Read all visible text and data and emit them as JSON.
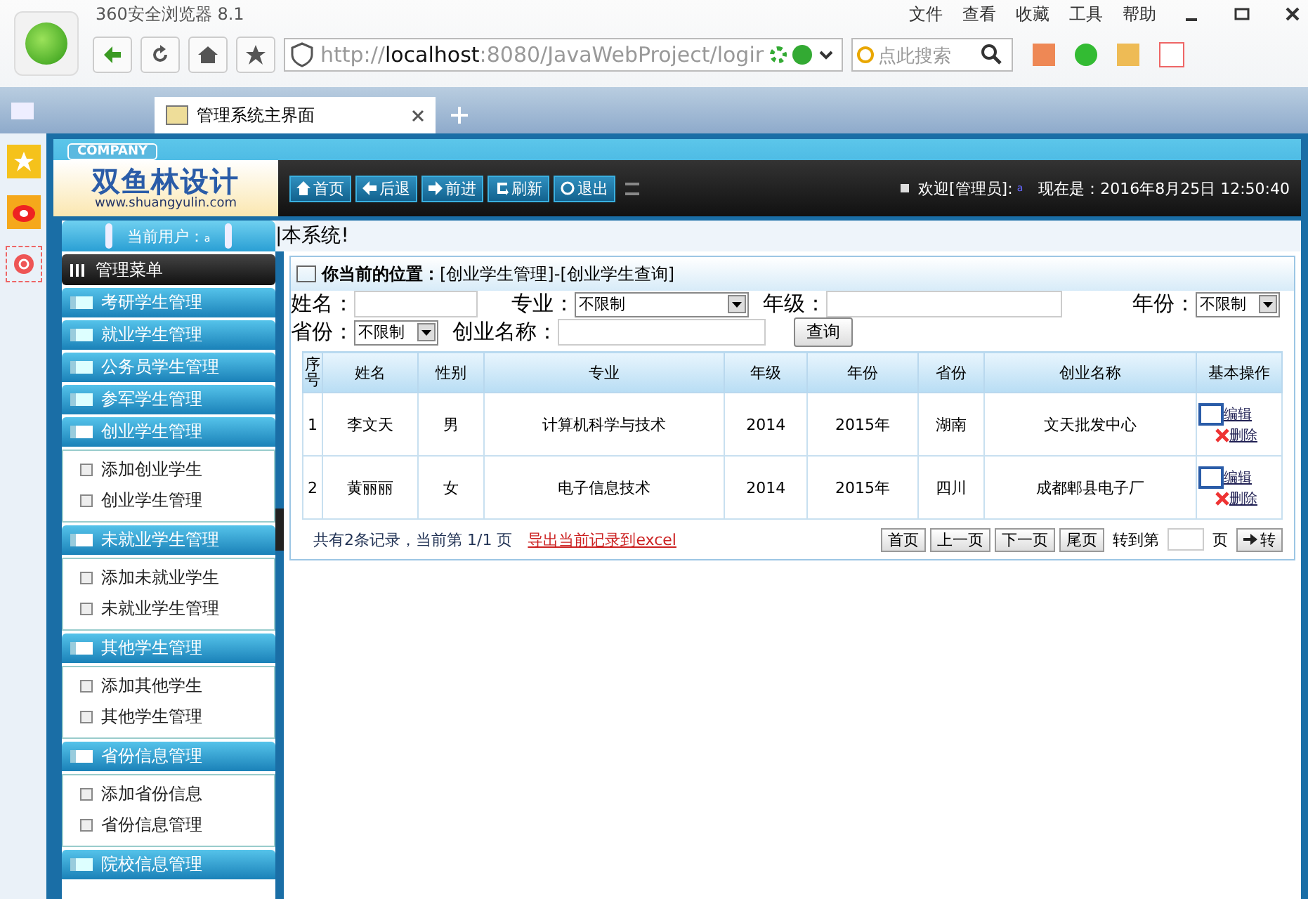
{
  "browser": {
    "title": "360安全浏览器 8.1",
    "menu": [
      "文件",
      "查看",
      "收藏",
      "工具",
      "帮助"
    ],
    "url": {
      "scheme": "http://",
      "host": "localhost",
      "path": ":8080/JavaWebProject/logir"
    },
    "search": {
      "placeholder": "点此搜索"
    },
    "tabs": [
      {
        "label": "管理系统主界面",
        "selected": true
      }
    ]
  },
  "header": {
    "company": "COMPANY",
    "logo": "双鱼林设计",
    "site": "www.shuangyulin.com",
    "nav": [
      "首页",
      "后退",
      "前进",
      "刷新",
      "退出"
    ],
    "welcome": "欢迎[管理员]:",
    "user": "a",
    "time": "现在是：2016年8月25日 12:50:40"
  },
  "marquee": "|本系统!",
  "sidebar": {
    "user_label": "当前用户：",
    "user": "a",
    "menu_title": "管理菜单",
    "groups": [
      {
        "title": "考研学生管理",
        "expanded": false
      },
      {
        "title": "就业学生管理",
        "expanded": false
      },
      {
        "title": "公务员学生管理",
        "expanded": false
      },
      {
        "title": "参军学生管理",
        "expanded": false
      },
      {
        "title": "创业学生管理",
        "expanded": true,
        "items": [
          "添加创业学生",
          "创业学生管理"
        ]
      },
      {
        "title": "未就业学生管理",
        "expanded": true,
        "items": [
          "添加未就业学生",
          "未就业学生管理"
        ]
      },
      {
        "title": "其他学生管理",
        "expanded": true,
        "items": [
          "添加其他学生",
          "其他学生管理"
        ]
      },
      {
        "title": "省份信息管理",
        "expanded": true,
        "items": [
          "添加省份信息",
          "省份信息管理"
        ]
      },
      {
        "title": "院校信息管理",
        "expanded": false
      }
    ]
  },
  "breadcrumb": {
    "label": "你当前的位置：",
    "path": "[创业学生管理]-[创业学生查询]"
  },
  "filters": [
    {
      "kind": "text",
      "label": "姓名："
    },
    {
      "kind": "select",
      "label": "专业：",
      "value": "不限制",
      "wide": true
    },
    {
      "kind": "text",
      "label": "年级："
    },
    {
      "kind": "select",
      "label": "年份：",
      "value": "不限制",
      "wide": false
    },
    {
      "kind": "select",
      "label": "省份：",
      "value": "不限制",
      "wide": false
    },
    {
      "kind": "text",
      "label": "创业名称："
    }
  ],
  "query_button": "查询",
  "table": {
    "columns": [
      "序号",
      "姓名",
      "性别",
      "专业",
      "年级",
      "年份",
      "省份",
      "创业名称",
      "基本操作"
    ],
    "rows": [
      {
        "cells": [
          "1",
          "李文天",
          "男",
          "计算机科学与技术",
          "2014",
          "2015年",
          "湖南",
          "文天批发中心"
        ],
        "actions": [
          "编辑",
          "删除"
        ]
      },
      {
        "cells": [
          "2",
          "黄丽丽",
          "女",
          "电子信息技术",
          "2014",
          "2015年",
          "四川",
          "成都郫县电子厂"
        ],
        "actions": [
          "编辑",
          "删除"
        ]
      }
    ]
  },
  "footer": {
    "summary": "共有2条记录，当前第 1/1 页",
    "export": "导出当前记录到excel",
    "pager": [
      "首页",
      "上一页",
      "下一页",
      "尾页"
    ],
    "goto_label": "转到第",
    "page_unit": "页",
    "go": "转"
  }
}
